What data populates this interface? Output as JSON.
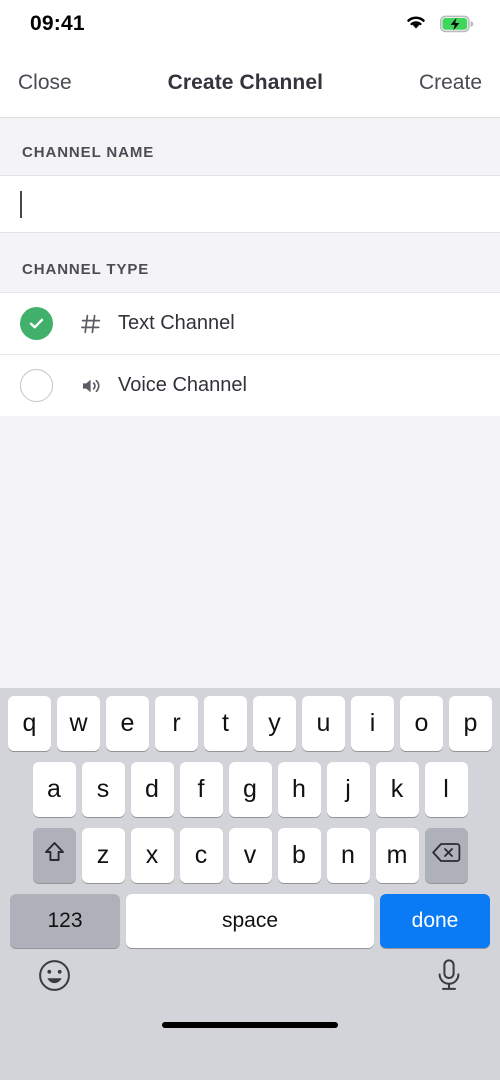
{
  "status_bar": {
    "time": "09:41",
    "wifi_icon": "wifi-icon",
    "battery_icon": "battery-charging-icon",
    "battery_color": "#3ED75B"
  },
  "nav_bar": {
    "close_label": "Close",
    "title": "Create Channel",
    "create_label": "Create",
    "text_color": "#4A4A52"
  },
  "channel_name_section": {
    "header": "CHANNEL NAME",
    "input_value": "",
    "input_placeholder": ""
  },
  "channel_type_section": {
    "header": "CHANNEL TYPE",
    "selected": "Text Channel",
    "options": [
      {
        "label": "Text Channel",
        "icon": "hash-icon",
        "icon_glyph": "#",
        "selected": true
      },
      {
        "label": "Voice Channel",
        "icon": "speaker-icon",
        "icon_glyph": "",
        "selected": false
      }
    ],
    "selected_color": "#41B06A"
  },
  "keyboard": {
    "row1": [
      "q",
      "w",
      "e",
      "r",
      "t",
      "y",
      "u",
      "i",
      "o",
      "p"
    ],
    "row2": [
      "a",
      "s",
      "d",
      "f",
      "g",
      "h",
      "j",
      "k",
      "l"
    ],
    "row3": [
      "z",
      "x",
      "c",
      "v",
      "b",
      "n",
      "m"
    ],
    "shift_icon": "shift-icon",
    "backspace_icon": "backspace-icon",
    "numbers_label": "123",
    "space_label": "space",
    "done_label": "done",
    "done_color": "#0B7BF5",
    "emoji_icon": "emoji-icon",
    "microphone_icon": "microphone-icon",
    "background_color": "#D2D4DA"
  },
  "home_indicator": "home-indicator"
}
